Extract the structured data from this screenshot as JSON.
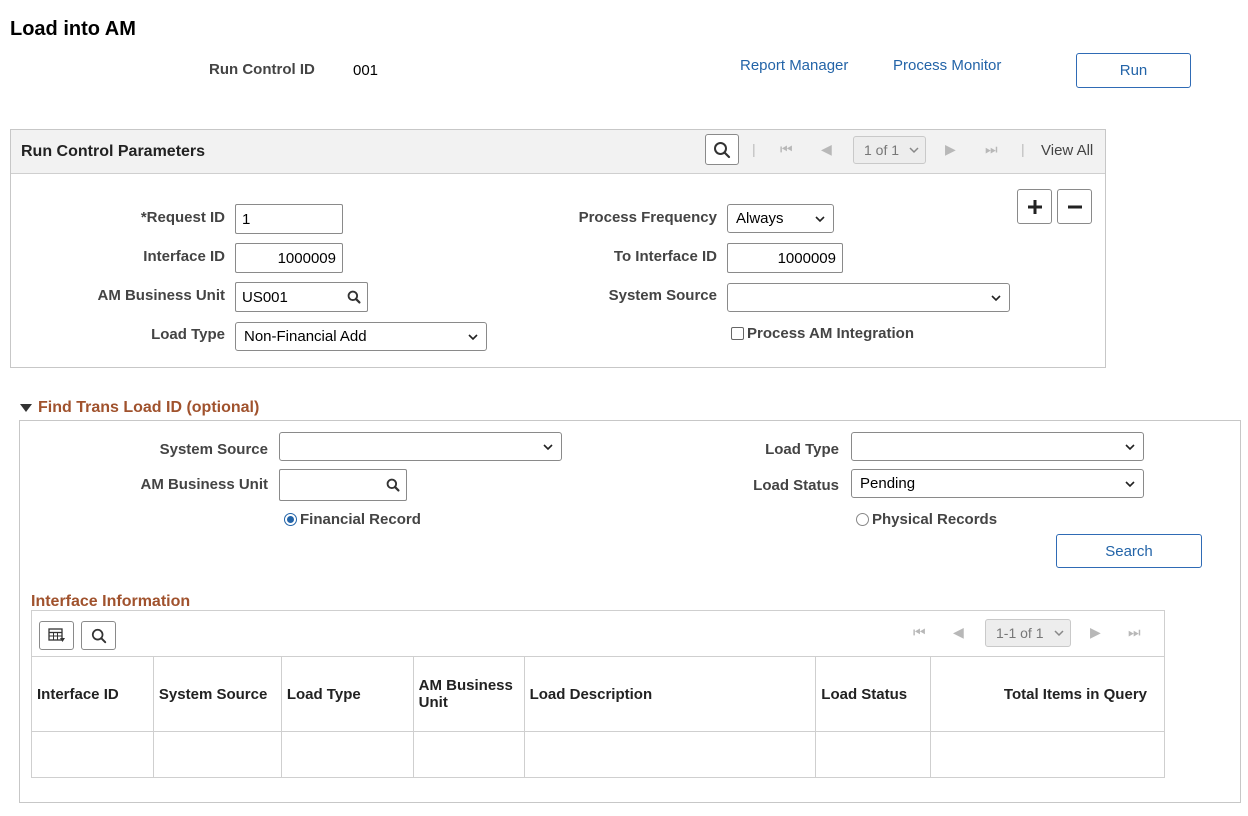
{
  "page": {
    "title": "Load into AM",
    "run_control_label": "Run Control ID",
    "run_control_value": "001",
    "report_manager": "Report Manager",
    "process_monitor": "Process Monitor",
    "run_label": "Run"
  },
  "parameters": {
    "header": "Run Control Parameters",
    "pager": "1 of 1",
    "view_all": "View All",
    "request_id_label": "*Request ID",
    "request_id_value": "1",
    "interface_id_label": "Interface ID",
    "interface_id_value": "1000009",
    "business_unit_label": "AM Business Unit",
    "business_unit_value": "US001",
    "load_type_label": "Load Type",
    "load_type_value": "Non-Financial Add",
    "process_frequency_label": "Process Frequency",
    "process_frequency_value": "Always",
    "to_interface_id_label": "To Interface ID",
    "to_interface_id_value": "1000009",
    "system_source_label": "System Source",
    "system_source_value": "",
    "process_am_integration_label": "Process AM Integration"
  },
  "find": {
    "header": "Find Trans Load ID (optional)",
    "system_source_label": "System Source",
    "system_source_value": "",
    "business_unit_label": "AM Business Unit",
    "business_unit_value": "",
    "load_type_label": "Load Type",
    "load_type_value": "",
    "load_status_label": "Load Status",
    "load_status_value": "Pending",
    "financial_record_label": "Financial Record",
    "physical_records_label": "Physical Records",
    "search_label": "Search"
  },
  "interface": {
    "header": "Interface Information",
    "pager": "1-1 of 1",
    "columns": {
      "interface_id": "Interface ID",
      "system_source": "System Source",
      "load_type": "Load Type",
      "am_bu": "AM Business Unit",
      "load_description": "Load Description",
      "load_status": "Load Status",
      "total_items": "Total Items in Query"
    }
  },
  "colors": {
    "link": "#2364a8",
    "section_title": "#a0522d",
    "header_bg": "#f2f2f2"
  },
  "icons": [
    "search-icon",
    "first-page-icon",
    "prev-page-icon",
    "next-page-icon",
    "last-page-icon",
    "add-row-icon",
    "delete-row-icon",
    "triangle-down-icon",
    "grid-personalize-icon",
    "chevron-down-icon"
  ]
}
